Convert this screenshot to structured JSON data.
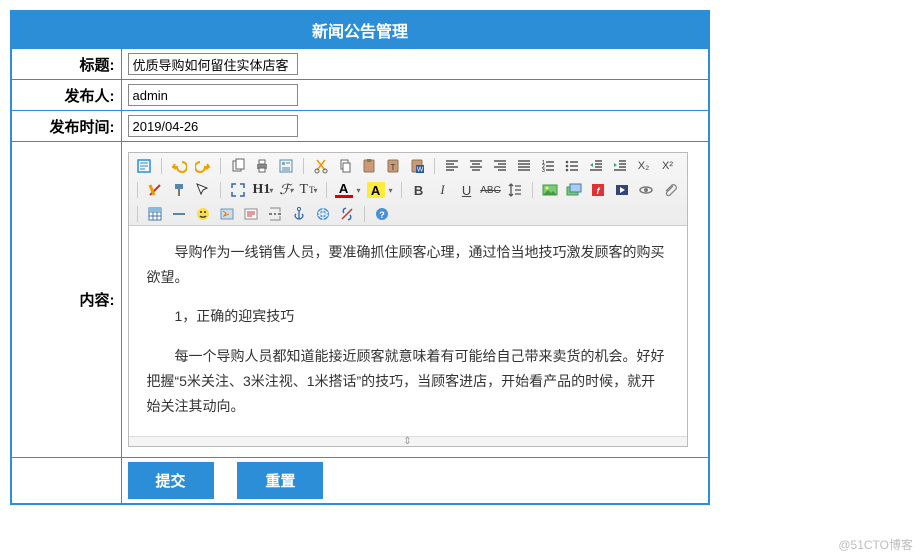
{
  "header": {
    "title": "新闻公告管理"
  },
  "labels": {
    "title": "标题:",
    "publisher": "发布人:",
    "publishTime": "发布时间:",
    "content": "内容:"
  },
  "fields": {
    "title": "优质导购如何留住实体店客",
    "publisher": "admin",
    "publishTime": "2019/04-26"
  },
  "editor": {
    "p1": "导购作为一线销售人员，要准确抓住顾客心理，通过恰当地技巧激发顾客的购买欲望。",
    "p2": "1，正确的迎宾技巧",
    "p3": "每一个导购人员都知道能接近顾客就意味着有可能给自己带来卖货的机会。好好把握“5米关注、3米注视、1米搭话”的技巧，当顾客进店，开始看产品的时候，就开始关注其动向。"
  },
  "toolbar": {
    "h1": "H1",
    "fontFamily": "ℱ",
    "fontSize": "ᴛT",
    "A": "A",
    "bold": "B",
    "italic": "I",
    "underline": "U",
    "strike": "ABC",
    "x2": "X₂",
    "x2sup": "X²"
  },
  "buttons": {
    "submit": "提交",
    "reset": "重置"
  },
  "watermark": "@51CTO博客"
}
